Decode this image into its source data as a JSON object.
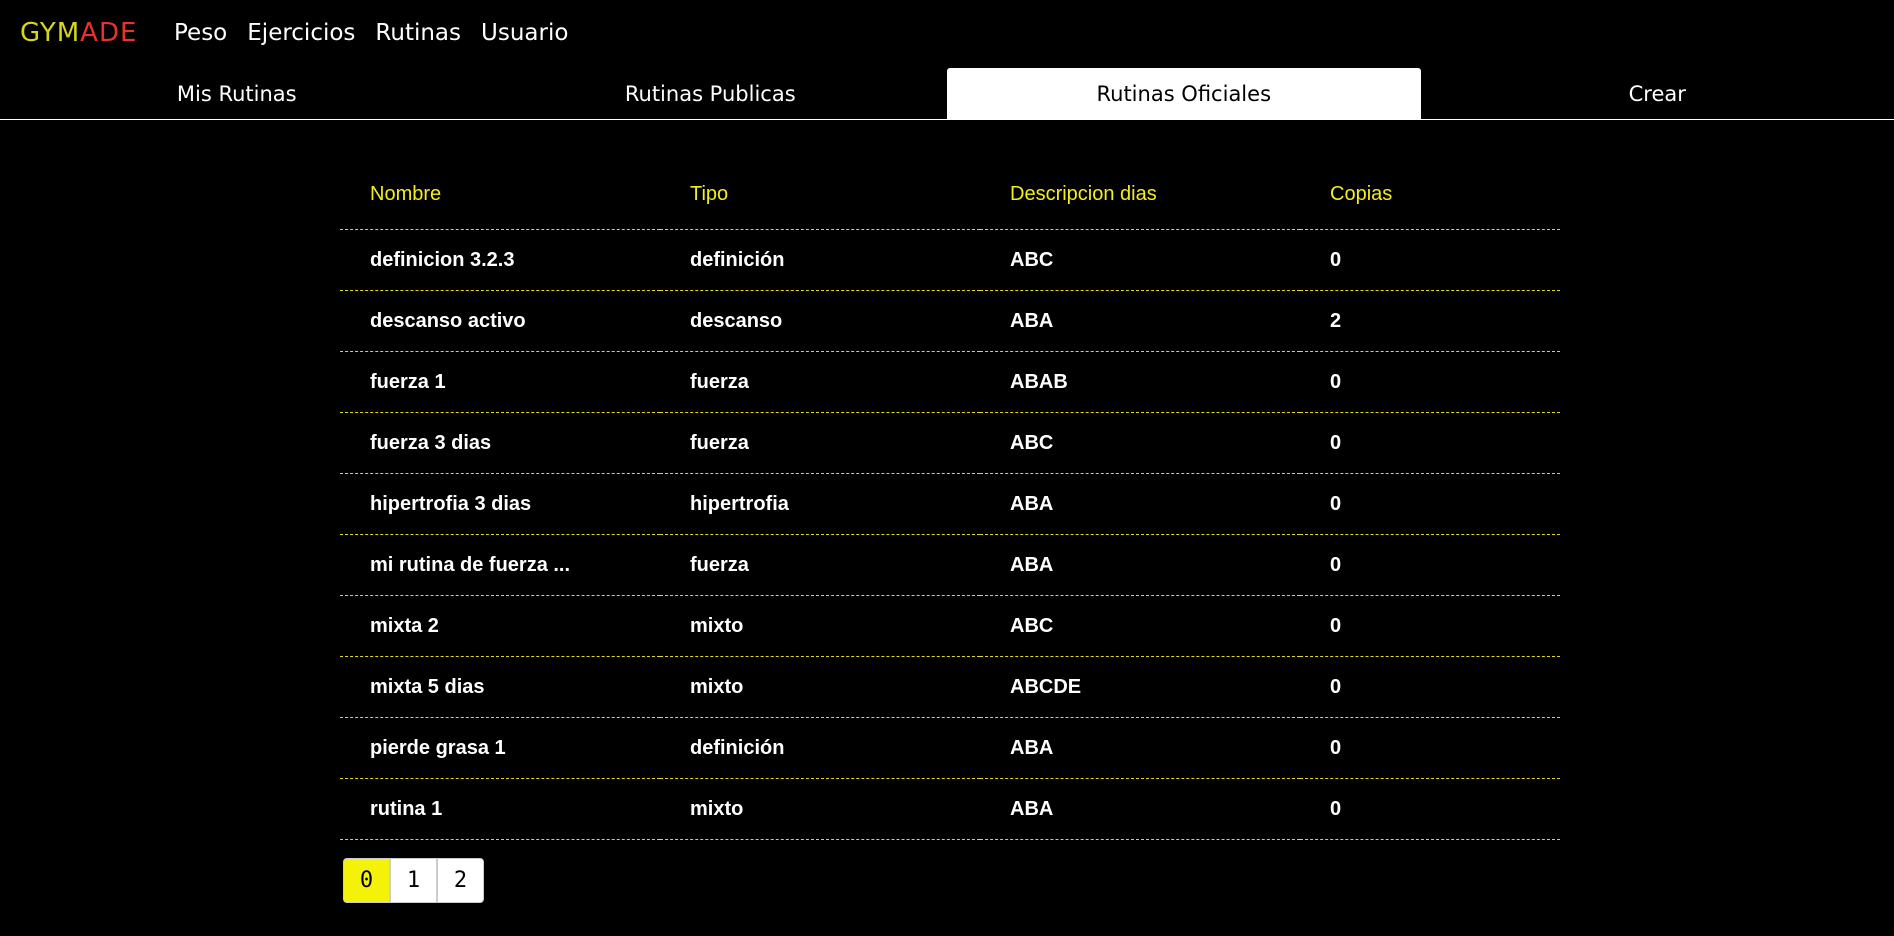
{
  "logo": {
    "gym": "GYM",
    "ade": "ADE"
  },
  "nav": {
    "links": [
      "Peso",
      "Ejercicios",
      "Rutinas",
      "Usuario"
    ]
  },
  "tabs": [
    {
      "label": "Mis Rutinas",
      "active": false
    },
    {
      "label": "Rutinas Publicas",
      "active": false
    },
    {
      "label": "Rutinas Oficiales",
      "active": true
    },
    {
      "label": "Crear",
      "active": false
    }
  ],
  "table": {
    "headers": [
      "Nombre",
      "Tipo",
      "Descripcion dias",
      "Copias"
    ],
    "rows": [
      [
        "definicion 3.2.3",
        "definición",
        "ABC",
        "0"
      ],
      [
        "descanso activo",
        "descanso",
        "ABA",
        "2"
      ],
      [
        "fuerza 1",
        "fuerza",
        "ABAB",
        "0"
      ],
      [
        "fuerza 3 dias",
        "fuerza",
        "ABC",
        "0"
      ],
      [
        "hipertrofia 3 dias",
        "hipertrofia",
        "ABA",
        "0"
      ],
      [
        "mi rutina de fuerza ...",
        "fuerza",
        "ABA",
        "0"
      ],
      [
        "mixta 2",
        "mixto",
        "ABC",
        "0"
      ],
      [
        "mixta 5 dias",
        "mixto",
        "ABCDE",
        "0"
      ],
      [
        "pierde grasa 1",
        "definición",
        "ABA",
        "0"
      ],
      [
        "rutina 1",
        "mixto",
        "ABA",
        "0"
      ]
    ]
  },
  "pagination": {
    "pages": [
      "0",
      "1",
      "2"
    ],
    "current": "0"
  },
  "colors": {
    "accent": "#f2ef1a",
    "logo_gym": "#d6d61a",
    "logo_ade": "#e8322c",
    "background": "#000000"
  }
}
